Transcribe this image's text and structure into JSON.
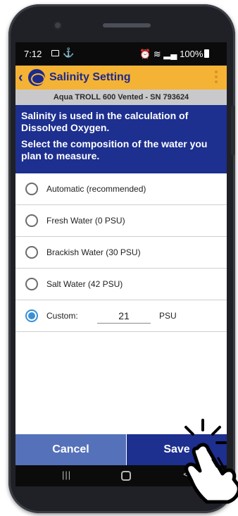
{
  "status_bar": {
    "time": "7:12",
    "right_text": "100%"
  },
  "header": {
    "title": "Salinity Setting",
    "back_icon": "chevron-left-icon",
    "menu_icon": "overflow-menu-icon"
  },
  "device": {
    "name": "Aqua TROLL 600 Vented - SN 793624"
  },
  "info": {
    "line1": "Salinity is used in the calculation of Dissolved Oxygen.",
    "line2": "Select the composition of the water you plan to measure."
  },
  "options": [
    {
      "label": "Automatic (recommended)",
      "selected": false
    },
    {
      "label": "Fresh Water (0 PSU)",
      "selected": false
    },
    {
      "label": "Brackish Water (30 PSU)",
      "selected": false
    },
    {
      "label": "Salt Water (42 PSU)",
      "selected": false
    },
    {
      "label": "Custom:",
      "selected": true
    }
  ],
  "custom": {
    "value": "21",
    "unit": "PSU"
  },
  "buttons": {
    "cancel": "Cancel",
    "save": "Save"
  },
  "nav": {
    "recents": "|||",
    "back": "<"
  },
  "colors": {
    "header_bg": "#f5b335",
    "brand_blue": "#1d2f8f",
    "cancel_blue": "#5571b9",
    "radio_selected": "#3a8fd6"
  }
}
